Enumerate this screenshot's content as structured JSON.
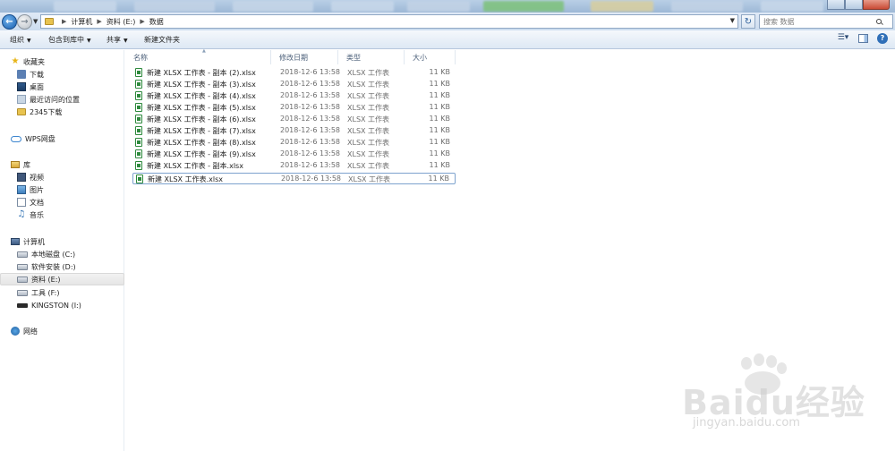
{
  "addressbar": {
    "crumbs": [
      "计算机",
      "资料 (E:)",
      "数据"
    ],
    "search_placeholder": "搜索 数据"
  },
  "toolbar": {
    "organize": "组织",
    "include_in_library": "包含到库中",
    "share": "共享",
    "new_folder": "新建文件夹"
  },
  "sidebar": {
    "favorites": "收藏夹",
    "fav_items": [
      "下载",
      "桌面",
      "最近访问的位置",
      "2345下载"
    ],
    "wps": "WPS网盘",
    "libraries": "库",
    "lib_items": [
      "视频",
      "图片",
      "文档",
      "音乐"
    ],
    "computer": "计算机",
    "drives": [
      "本地磁盘 (C:)",
      "软件安装 (D:)",
      "资料 (E:)",
      "工具 (F:)",
      "KINGSTON (I:)"
    ],
    "network": "网络"
  },
  "columns": [
    "名称",
    "修改日期",
    "类型",
    "大小"
  ],
  "files": [
    {
      "name": "新建 XLSX 工作表 - 副本 (2).xlsx",
      "date": "2018-12-6 13:58",
      "type": "XLSX 工作表",
      "size": "11 KB"
    },
    {
      "name": "新建 XLSX 工作表 - 副本 (3).xlsx",
      "date": "2018-12-6 13:58",
      "type": "XLSX 工作表",
      "size": "11 KB"
    },
    {
      "name": "新建 XLSX 工作表 - 副本 (4).xlsx",
      "date": "2018-12-6 13:58",
      "type": "XLSX 工作表",
      "size": "11 KB"
    },
    {
      "name": "新建 XLSX 工作表 - 副本 (5).xlsx",
      "date": "2018-12-6 13:58",
      "type": "XLSX 工作表",
      "size": "11 KB"
    },
    {
      "name": "新建 XLSX 工作表 - 副本 (6).xlsx",
      "date": "2018-12-6 13:58",
      "type": "XLSX 工作表",
      "size": "11 KB"
    },
    {
      "name": "新建 XLSX 工作表 - 副本 (7).xlsx",
      "date": "2018-12-6 13:58",
      "type": "XLSX 工作表",
      "size": "11 KB"
    },
    {
      "name": "新建 XLSX 工作表 - 副本 (8).xlsx",
      "date": "2018-12-6 13:58",
      "type": "XLSX 工作表",
      "size": "11 KB"
    },
    {
      "name": "新建 XLSX 工作表 - 副本 (9).xlsx",
      "date": "2018-12-6 13:58",
      "type": "XLSX 工作表",
      "size": "11 KB"
    },
    {
      "name": "新建 XLSX 工作表 - 副本.xlsx",
      "date": "2018-12-6 13:58",
      "type": "XLSX 工作表",
      "size": "11 KB"
    },
    {
      "name": "新建 XLSX 工作表.xlsx",
      "date": "2018-12-6 13:58",
      "type": "XLSX 工作表",
      "size": "11 KB"
    }
  ],
  "watermark": {
    "brand": "Baidu经验",
    "url": "jingyan.baidu.com"
  }
}
